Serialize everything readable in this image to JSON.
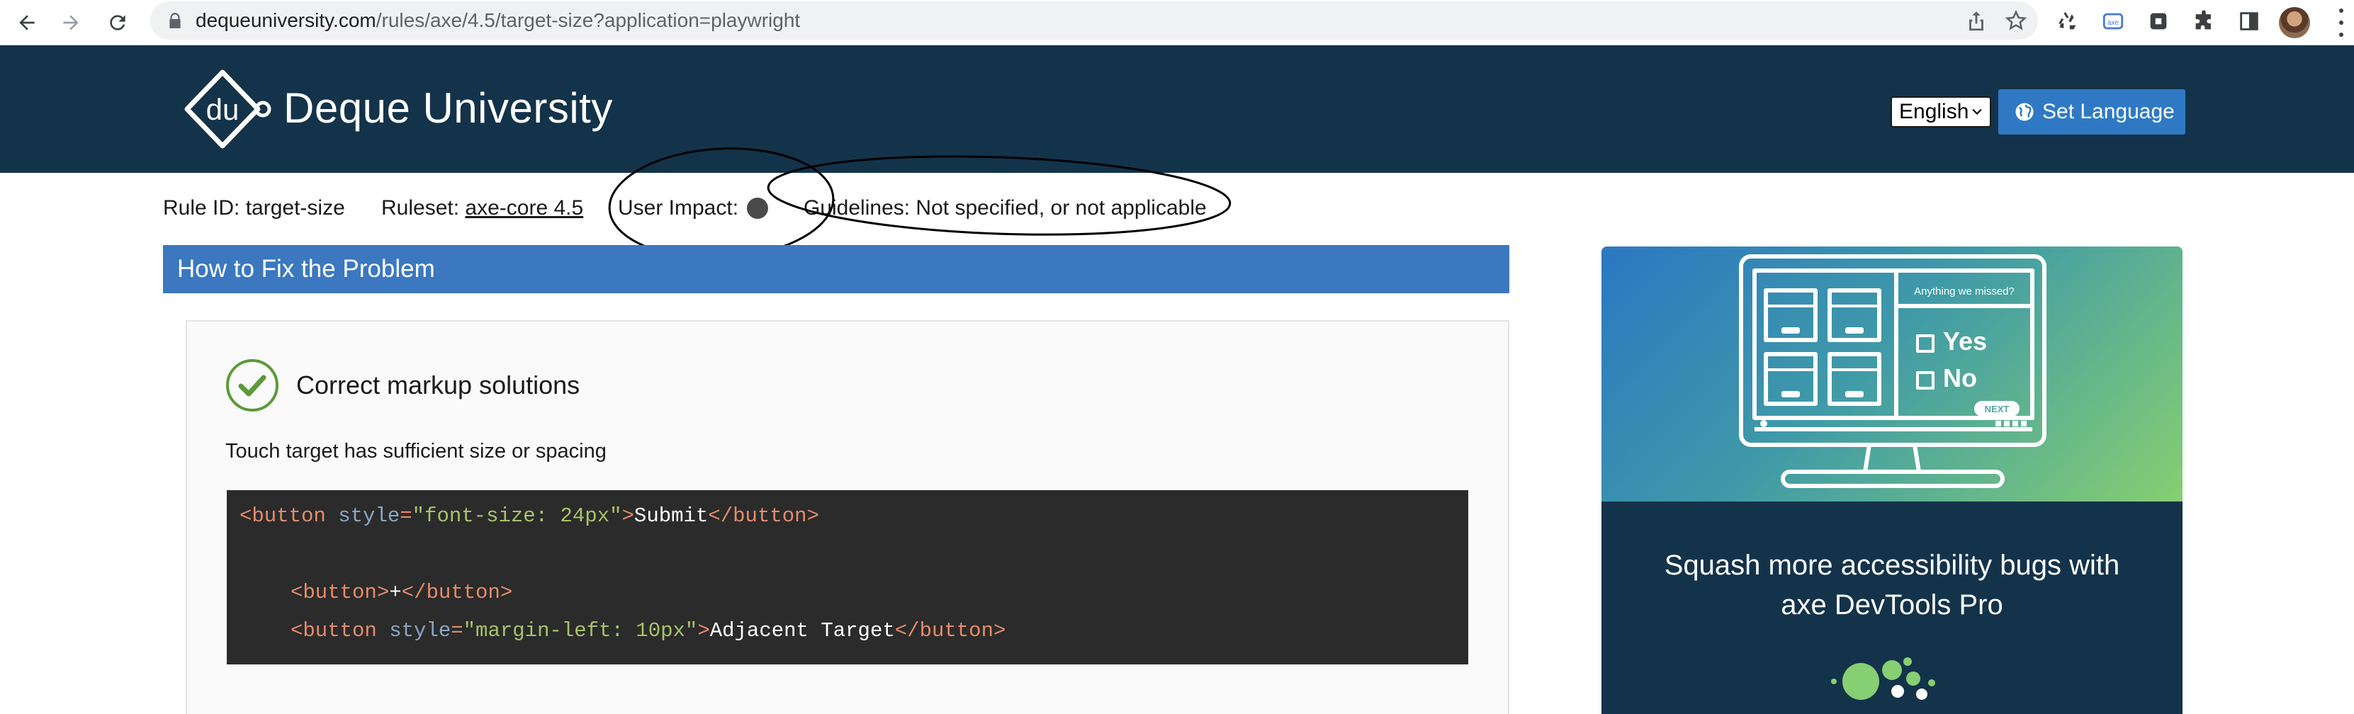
{
  "browser": {
    "url_host": "dequeuniversity.com",
    "url_path": "/rules/axe/4.5/target-size?application=playwright"
  },
  "header": {
    "brand": "Deque University",
    "language_selected": "English",
    "set_language_label": "Set Language"
  },
  "meta": {
    "rule_id": "Rule ID: target-size",
    "ruleset_label": "Ruleset:",
    "ruleset_link": "axe-core 4.5",
    "user_impact_label": "User Impact:",
    "guidelines": "Guidelines: Not specified, or not applicable"
  },
  "section": {
    "title": "How to Fix the Problem",
    "solution_title": "Correct markup solutions",
    "solution_desc": "Touch target has sufficient size or spacing"
  },
  "code": {
    "l1_open": "<button ",
    "l1_attr": "style",
    "l1_eq": "=",
    "l1_val": "\"font-size: 24px\"",
    "l1_close": ">",
    "l1_text": "Submit",
    "l1_end": "</button>",
    "l2_open": "<button>",
    "l2_text": "+",
    "l2_end": "</button>",
    "l3_open": "<button ",
    "l3_attr": "style",
    "l3_eq": "=",
    "l3_val": "\"margin-left: 10px\"",
    "l3_close": ">",
    "l3_text": "Adjacent Target",
    "l3_end": "</button>"
  },
  "promo": {
    "art_question": "Anything we missed?",
    "art_yes": "Yes",
    "art_no": "No",
    "art_next": "NEXT",
    "text": "Squash more accessibility bugs with axe DevTools Pro"
  },
  "colors": {
    "header_bg": "#13334a",
    "section_bar": "#3b78c0",
    "button_blue": "#2f79c4",
    "check_green": "#5b9a3a"
  }
}
